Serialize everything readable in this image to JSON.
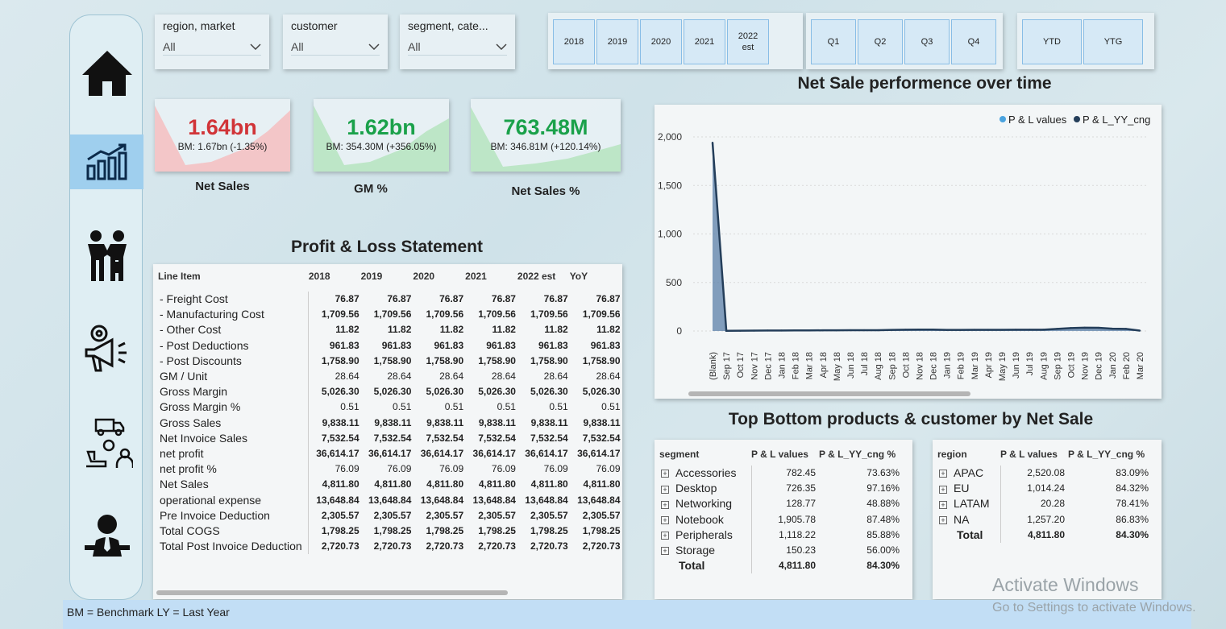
{
  "slicers": [
    {
      "label": "region, market",
      "value": "All"
    },
    {
      "label": "customer",
      "value": "All"
    },
    {
      "label": "segment, cate...",
      "value": "All"
    }
  ],
  "years": [
    "2018",
    "2019",
    "2020",
    "2021",
    "2022\nest"
  ],
  "quarters": [
    "Q1",
    "Q2",
    "Q3",
    "Q4"
  ],
  "periods": [
    "YTD",
    "YTG"
  ],
  "kpis": [
    {
      "value": "1.64bn",
      "bm": "BM: 1.67bn (-1.35%)",
      "title": "Net Sales",
      "color": "#d13438",
      "fill": "#f3c6c8"
    },
    {
      "value": "1.62bn",
      "bm": "BM: 354.30M (+356.05%)",
      "title": "GM %",
      "color": "#1aa14a",
      "fill": "#bde6c7"
    },
    {
      "value": "763.48M",
      "bm": "BM: 346.81M (+120.14%)",
      "title": "Net Sales %",
      "color": "#1aa14a",
      "fill": "#bde6c7"
    }
  ],
  "pl": {
    "title": "Profit & Loss Statement",
    "headers": [
      "Line Item",
      "2018",
      "2019",
      "2020",
      "2021",
      "2022 est",
      "YoY"
    ],
    "rows": [
      {
        "item": "- Freight Cost",
        "v": "76.87"
      },
      {
        "item": "- Manufacturing Cost",
        "v": "1,709.56"
      },
      {
        "item": "- Other Cost",
        "v": "11.82"
      },
      {
        "item": "- Post Deductions",
        "v": "961.83"
      },
      {
        "item": "- Post Discounts",
        "v": "1,758.90"
      },
      {
        "item": "GM / Unit",
        "v": "28.64"
      },
      {
        "item": "Gross Margin",
        "v": "5,026.30"
      },
      {
        "item": "Gross Margin %",
        "v": "0.51"
      },
      {
        "item": "Gross Sales",
        "v": "9,838.11"
      },
      {
        "item": "Net Invoice Sales",
        "v": "7,532.54"
      },
      {
        "item": "net profit",
        "v": "36,614.17"
      },
      {
        "item": "net profit %",
        "v": "76.09"
      },
      {
        "item": "Net Sales",
        "v": "4,811.80"
      },
      {
        "item": "operational expense",
        "v": "13,648.84"
      },
      {
        "item": "Pre Invoice Deduction",
        "v": "2,305.57"
      },
      {
        "item": "Total COGS",
        "v": "1,798.25"
      },
      {
        "item": "Total Post Invoice Deduction",
        "v": "2,720.73"
      }
    ]
  },
  "chart_title": "Net Sale performence over time",
  "chart_data": {
    "type": "area",
    "x": [
      "(Blank)",
      "Sep 17",
      "Oct 17",
      "Nov 17",
      "Dec 17",
      "Jan 18",
      "Feb 18",
      "Mar 18",
      "Apr 18",
      "May 18",
      "Jun 18",
      "Jul 18",
      "Aug 18",
      "Sep 18",
      "Oct 18",
      "Nov 18",
      "Dec 18",
      "Jan 19",
      "Feb 19",
      "Mar 19",
      "Apr 19",
      "May 19",
      "Jun 19",
      "Jul 19",
      "Aug 19",
      "Sep 19",
      "Oct 19",
      "Nov 19",
      "Dec 19",
      "Jan 20",
      "Feb 20",
      "Mar 20"
    ],
    "series": [
      {
        "name": "P & L values",
        "color": "#4aa3df",
        "values": [
          1930,
          2,
          3,
          4,
          5,
          6,
          6,
          7,
          7,
          8,
          8,
          9,
          9,
          12,
          14,
          16,
          16,
          12,
          12,
          13,
          13,
          13,
          14,
          15,
          16,
          25,
          35,
          40,
          38,
          28,
          25,
          5
        ]
      },
      {
        "name": "P & L_YY_cng",
        "color": "#243e5a",
        "values": [
          1940,
          2,
          3,
          4,
          5,
          5,
          6,
          6,
          7,
          7,
          8,
          8,
          8,
          11,
          13,
          15,
          15,
          11,
          11,
          12,
          12,
          12,
          13,
          13,
          14,
          22,
          30,
          34,
          33,
          24,
          22,
          4
        ]
      }
    ],
    "ylim": [
      0,
      2000
    ],
    "yticks": [
      "0",
      "500",
      "1,000",
      "1,500",
      "2,000"
    ],
    "legend_position": "top-right",
    "grid": true
  },
  "tb_title": "Top Bottom products & customer by Net Sale",
  "segment_table": {
    "headers": [
      "segment",
      "P & L values",
      "P & L_YY_cng %"
    ],
    "rows": [
      [
        "Accessories",
        "782.45",
        "73.63%"
      ],
      [
        "Desktop",
        "726.35",
        "97.16%"
      ],
      [
        "Networking",
        "128.77",
        "48.88%"
      ],
      [
        "Notebook",
        "1,905.78",
        "87.48%"
      ],
      [
        "Peripherals",
        "1,118.22",
        "85.88%"
      ],
      [
        "Storage",
        "150.23",
        "56.00%"
      ]
    ],
    "total": [
      "Total",
      "4,811.80",
      "84.30%"
    ]
  },
  "region_table": {
    "headers": [
      "region",
      "P & L values",
      "P & L_YY_cng %"
    ],
    "rows": [
      [
        "APAC",
        "2,520.08",
        "83.09%"
      ],
      [
        "EU",
        "1,014.24",
        "84.32%"
      ],
      [
        "LATAM",
        "20.28",
        "78.41%"
      ],
      [
        "NA",
        "1,257.20",
        "86.83%"
      ]
    ],
    "total": [
      "Total",
      "4,811.80",
      "84.30%"
    ]
  },
  "footer": "BM = Benchmark LY = Last Year",
  "watermark": {
    "line1": "Activate Windows",
    "line2": "Go to Settings to activate Windows."
  },
  "icons": [
    "home-icon",
    "chart-growth-icon",
    "handshake-icon",
    "marketing-megaphone-icon",
    "supply-chain-icon",
    "executive-icon",
    "chevron-down-icon",
    "expand-plus-icon"
  ]
}
